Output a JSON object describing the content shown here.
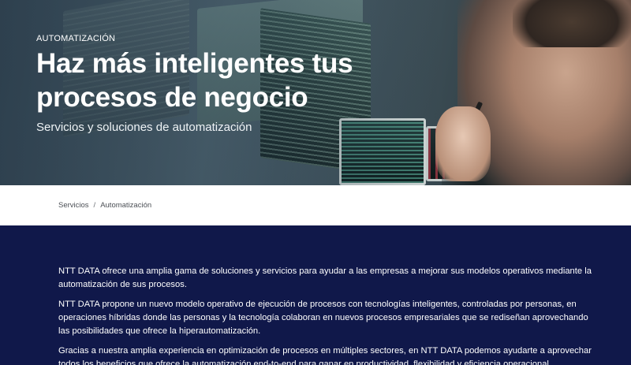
{
  "hero": {
    "eyebrow": "AUTOMATIZACIÓN",
    "title": "Haz más inteligentes tus procesos de negocio",
    "subtitle": "Servicios y soluciones de automatización"
  },
  "breadcrumb": {
    "items": [
      "Servicios",
      "Automatización"
    ],
    "separator": "/"
  },
  "content": {
    "paragraphs": [
      "NTT DATA ofrece una amplia gama de soluciones y servicios para ayudar a las empresas a mejorar sus modelos operativos mediante la automatización de sus procesos.",
      "NTT DATA propone un nuevo modelo operativo de ejecución de procesos con tecnologías inteligentes, controladas por personas, en operaciones híbridas donde las personas y la tecnología colaboran en nuevos procesos empresariales que se rediseñan aprovechando las posibilidades que ofrece la hiperautomatización.",
      "Gracias a nuestra amplia experiencia en optimización de procesos en múltiples sectores, en NTT DATA podemos ayudarte a aprovechar todos los beneficios que ofrece la automatización end-to-end para ganar en productividad, flexibilidad y eficiencia operacional."
    ]
  },
  "colors": {
    "content_background": "#10184a",
    "hero_text": "#ffffff",
    "breadcrumb_text": "#4b4f55"
  }
}
